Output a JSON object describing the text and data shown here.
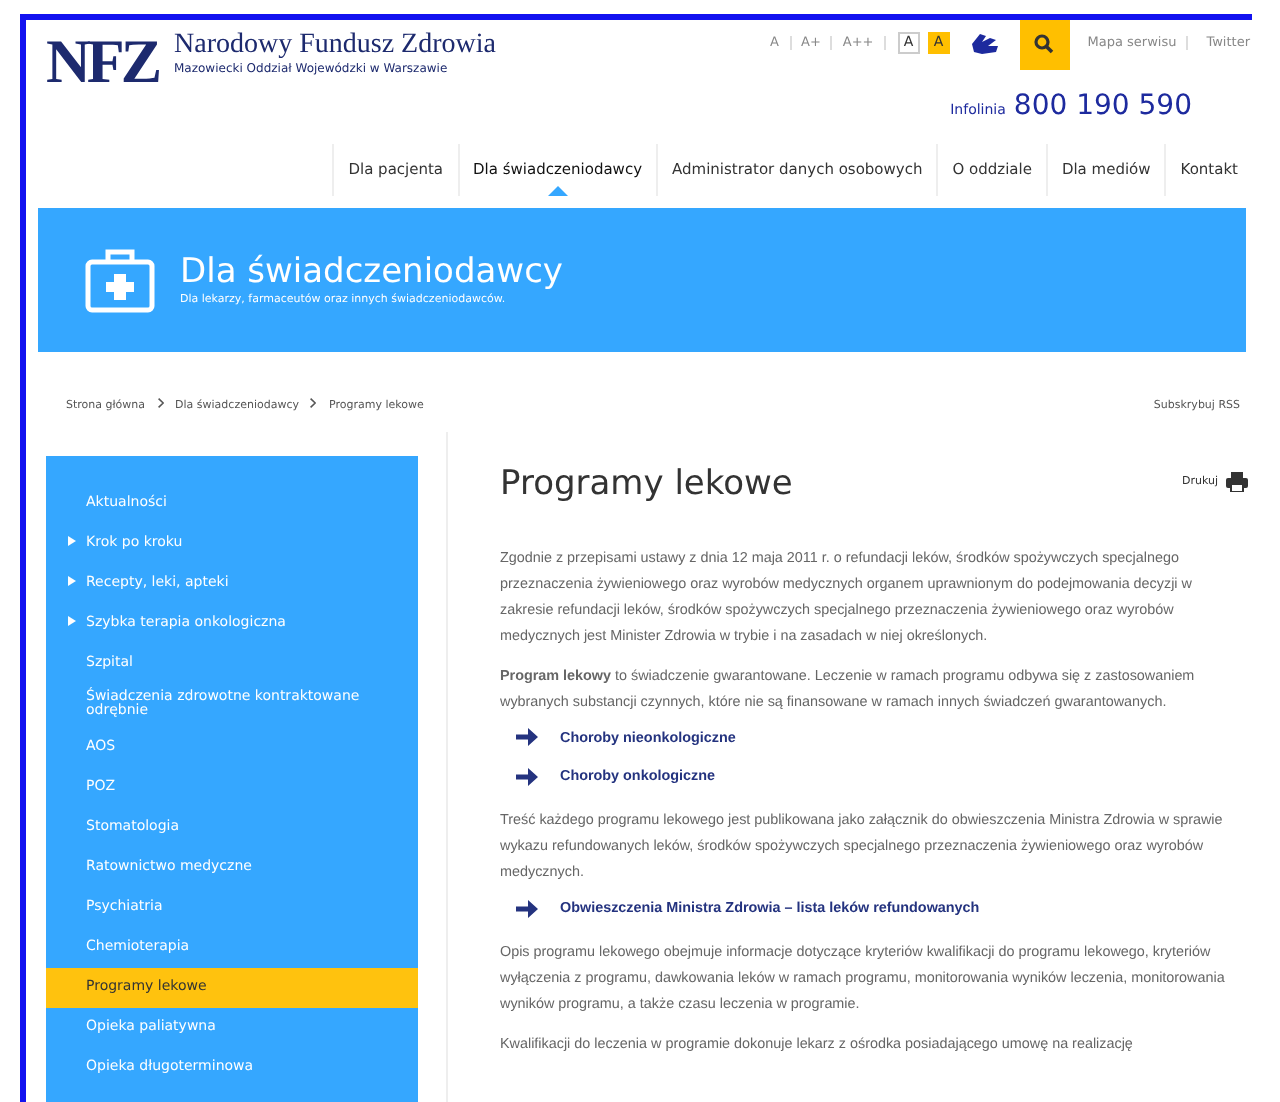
{
  "header": {
    "logo": "NFZ",
    "org_name": "Narodowy Fundusz Zdrowia",
    "org_subtitle": "Mazowiecki Oddział Wojewódzki w Warszawie",
    "font_sizes": [
      {
        "label": "A"
      },
      {
        "label": "A+"
      },
      {
        "label": "A++"
      }
    ],
    "contrast": [
      {
        "label": "A",
        "kind": "normal"
      },
      {
        "label": "A",
        "kind": "high"
      }
    ],
    "links": [
      "Mapa serwisu",
      "Twitter"
    ],
    "hotline": {
      "label": "Infolinia",
      "number": "800 190 590"
    }
  },
  "nav": [
    {
      "label": "Dla pacjenta",
      "selected": false
    },
    {
      "label": "Dla świadczeniodawcy",
      "selected": true
    },
    {
      "label": "Administrator danych osobowych",
      "selected": false
    },
    {
      "label": "O oddziale",
      "selected": false
    },
    {
      "label": "Dla mediów",
      "selected": false
    },
    {
      "label": "Kontakt",
      "selected": false
    }
  ],
  "banner": {
    "title": "Dla świadczeniodawcy",
    "subtitle": "Dla lekarzy, farmaceutów oraz innych świadczeniodawców."
  },
  "breadcrumb": [
    "Strona główna",
    "Dla świadczeniodawcy",
    "Programy lekowe"
  ],
  "rss": "Subskrybuj RSS",
  "sidebar": {
    "items": [
      {
        "label": "Aktualności",
        "expandable": false,
        "selected": false
      },
      {
        "label": "Krok po kroku",
        "expandable": true,
        "selected": false
      },
      {
        "label": "Recepty, leki, apteki",
        "expandable": true,
        "selected": false
      },
      {
        "label": "Szybka terapia onkologiczna",
        "expandable": true,
        "selected": false
      },
      {
        "label": "Szpital",
        "expandable": false,
        "selected": false
      },
      {
        "label": "Świadczenia zdrowotne kontraktowane odrębnie",
        "expandable": false,
        "selected": false
      },
      {
        "label": "AOS",
        "expandable": false,
        "selected": false
      },
      {
        "label": "POZ",
        "expandable": false,
        "selected": false
      },
      {
        "label": "Stomatologia",
        "expandable": false,
        "selected": false
      },
      {
        "label": "Ratownictwo medyczne",
        "expandable": false,
        "selected": false
      },
      {
        "label": "Psychiatria",
        "expandable": false,
        "selected": false
      },
      {
        "label": "Chemioterapia",
        "expandable": false,
        "selected": false
      },
      {
        "label": "Programy lekowe",
        "expandable": false,
        "selected": true
      },
      {
        "label": "Opieka paliatywna",
        "expandable": false,
        "selected": false
      },
      {
        "label": "Opieka długoterminowa",
        "expandable": false,
        "selected": false
      }
    ]
  },
  "content": {
    "title": "Programy lekowe",
    "print": "Drukuj",
    "blocks": [
      {
        "kind": "paragraph",
        "text": "Zgodnie z przepisami ustawy z dnia 12 maja 2011 r. o refundacji leków, środków spożywczych specjalnego przeznaczenia żywieniowego oraz wyrobów medycznych organem uprawnionym do podejmowania decyzji w zakresie refundacji leków, środków spożywczych specjalnego przeznaczenia żywieniowego oraz wyrobów medycznych jest Minister Zdrowia w trybie i na zasadach w niej określonych."
      },
      {
        "kind": "paragraph",
        "text": "**Program lekowy** to świadczenie gwarantowane. Leczenie w ramach programu odbywa się z zastosowaniem wybranych substancji czynnych, które nie są finansowane w ramach innych świadczeń gwarantowanych."
      },
      {
        "kind": "link",
        "text": "Choroby nieonkologiczne"
      },
      {
        "kind": "link",
        "text": "Choroby onkologiczne"
      },
      {
        "kind": "paragraph",
        "text": "Treść każdego programu lekowego jest publikowana jako załącznik do obwieszczenia Ministra Zdrowia w sprawie wykazu refundowanych leków, środków spożywczych specjalnego przeznaczenia żywieniowego oraz wyrobów medycznych."
      },
      {
        "kind": "link",
        "text": "Obwieszczenia Ministra Zdrowia – lista leków refundowanych"
      },
      {
        "kind": "paragraph",
        "text": "Opis programu lekowego obejmuje informacje dotyczące kryteriów kwalifikacji do programu lekowego, kryteriów wyłączenia z programu, dawkowania leków w ramach programu, monitorowania wyników leczenia, monitorowania wyników programu, a także czasu leczenia w programie."
      },
      {
        "kind": "paragraph",
        "text": "Kwalifikacji do leczenia w programie dokonuje lekarz z ośrodka posiadającego umowę na realizację"
      }
    ]
  }
}
